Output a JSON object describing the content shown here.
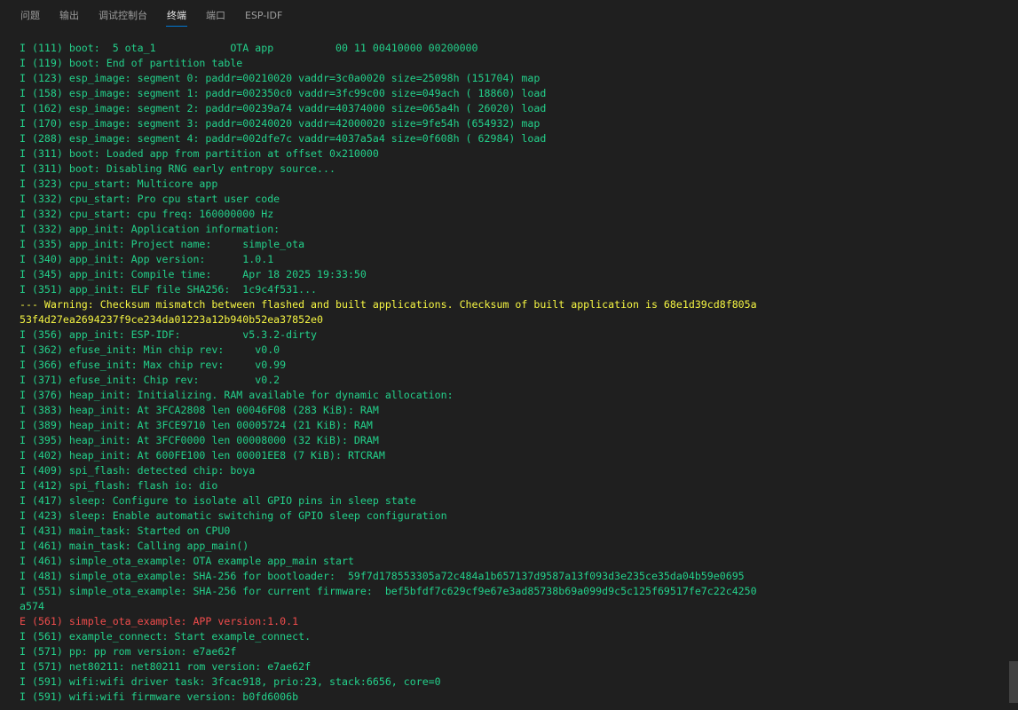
{
  "tabs": [
    {
      "label": "问题"
    },
    {
      "label": "输出"
    },
    {
      "label": "调试控制台"
    },
    {
      "label": "终端"
    },
    {
      "label": "端口"
    },
    {
      "label": "ESP-IDF"
    }
  ],
  "active_tab": "终端",
  "terminal": {
    "lines": [
      {
        "text": "I (111) boot:  5 ota_1            OTA app          00 11 00410000 00200000",
        "level": "info"
      },
      {
        "text": "I (119) boot: End of partition table",
        "level": "info"
      },
      {
        "text": "I (123) esp_image: segment 0: paddr=00210020 vaddr=3c0a0020 size=25098h (151704) map",
        "level": "info"
      },
      {
        "text": "I (158) esp_image: segment 1: paddr=002350c0 vaddr=3fc99c00 size=049ach ( 18860) load",
        "level": "info"
      },
      {
        "text": "I (162) esp_image: segment 2: paddr=00239a74 vaddr=40374000 size=065a4h ( 26020) load",
        "level": "info"
      },
      {
        "text": "I (170) esp_image: segment 3: paddr=00240020 vaddr=42000020 size=9fe54h (654932) map",
        "level": "info"
      },
      {
        "text": "I (288) esp_image: segment 4: paddr=002dfe7c vaddr=4037a5a4 size=0f608h ( 62984) load",
        "level": "info"
      },
      {
        "text": "I (311) boot: Loaded app from partition at offset 0x210000",
        "level": "info"
      },
      {
        "text": "I (311) boot: Disabling RNG early entropy source...",
        "level": "info"
      },
      {
        "text": "I (323) cpu_start: Multicore app",
        "level": "info"
      },
      {
        "text": "I (332) cpu_start: Pro cpu start user code",
        "level": "info"
      },
      {
        "text": "I (332) cpu_start: cpu freq: 160000000 Hz",
        "level": "info"
      },
      {
        "text": "I (332) app_init: Application information:",
        "level": "info"
      },
      {
        "text": "I (335) app_init: Project name:     simple_ota",
        "level": "info"
      },
      {
        "text": "I (340) app_init: App version:      1.0.1",
        "level": "info"
      },
      {
        "text": "I (345) app_init: Compile time:     Apr 18 2025 19:33:50",
        "level": "info"
      },
      {
        "text": "I (351) app_init: ELF file SHA256:  1c9c4f531...",
        "level": "info"
      },
      {
        "text": "--- Warning: Checksum mismatch between flashed and built applications. Checksum of built application is 68e1d39cd8f805a",
        "level": "warn"
      },
      {
        "text": "53f4d27ea2694237f9ce234da01223a12b940b52ea37852e0",
        "level": "warn"
      },
      {
        "text": "I (356) app_init: ESP-IDF:          v5.3.2-dirty",
        "level": "info"
      },
      {
        "text": "I (362) efuse_init: Min chip rev:     v0.0",
        "level": "info"
      },
      {
        "text": "I (366) efuse_init: Max chip rev:     v0.99",
        "level": "info"
      },
      {
        "text": "I (371) efuse_init: Chip rev:         v0.2",
        "level": "info"
      },
      {
        "text": "I (376) heap_init: Initializing. RAM available for dynamic allocation:",
        "level": "info"
      },
      {
        "text": "I (383) heap_init: At 3FCA2808 len 00046F08 (283 KiB): RAM",
        "level": "info"
      },
      {
        "text": "I (389) heap_init: At 3FCE9710 len 00005724 (21 KiB): RAM",
        "level": "info"
      },
      {
        "text": "I (395) heap_init: At 3FCF0000 len 00008000 (32 KiB): DRAM",
        "level": "info"
      },
      {
        "text": "I (402) heap_init: At 600FE100 len 00001EE8 (7 KiB): RTCRAM",
        "level": "info"
      },
      {
        "text": "I (409) spi_flash: detected chip: boya",
        "level": "info"
      },
      {
        "text": "I (412) spi_flash: flash io: dio",
        "level": "info"
      },
      {
        "text": "I (417) sleep: Configure to isolate all GPIO pins in sleep state",
        "level": "info"
      },
      {
        "text": "I (423) sleep: Enable automatic switching of GPIO sleep configuration",
        "level": "info"
      },
      {
        "text": "I (431) main_task: Started on CPU0",
        "level": "info"
      },
      {
        "text": "I (461) main_task: Calling app_main()",
        "level": "info"
      },
      {
        "text": "I (461) simple_ota_example: OTA example app_main start",
        "level": "info"
      },
      {
        "text": "I (481) simple_ota_example: SHA-256 for bootloader:  59f7d178553305a72c484a1b657137d9587a13f093d3e235ce35da04b59e0695",
        "level": "info"
      },
      {
        "text": "I (551) simple_ota_example: SHA-256 for current firmware:  bef5bfdf7c629cf9e67e3ad85738b69a099d9c5c125f69517fe7c22c4250",
        "level": "info"
      },
      {
        "text": "a574",
        "level": "info"
      },
      {
        "text": "E (561) simple_ota_example: APP version:1.0.1",
        "level": "err"
      },
      {
        "text": "I (561) example_connect: Start example_connect.",
        "level": "info"
      },
      {
        "text": "I (571) pp: pp rom version: e7ae62f",
        "level": "info"
      },
      {
        "text": "I (571) net80211: net80211 rom version: e7ae62f",
        "level": "info"
      },
      {
        "text": "I (591) wifi:wifi driver task: 3fcac918, prio:23, stack:6656, core=0",
        "level": "info"
      },
      {
        "text": "I (591) wifi:wifi firmware version: b0fd6006b",
        "level": "info"
      }
    ]
  }
}
